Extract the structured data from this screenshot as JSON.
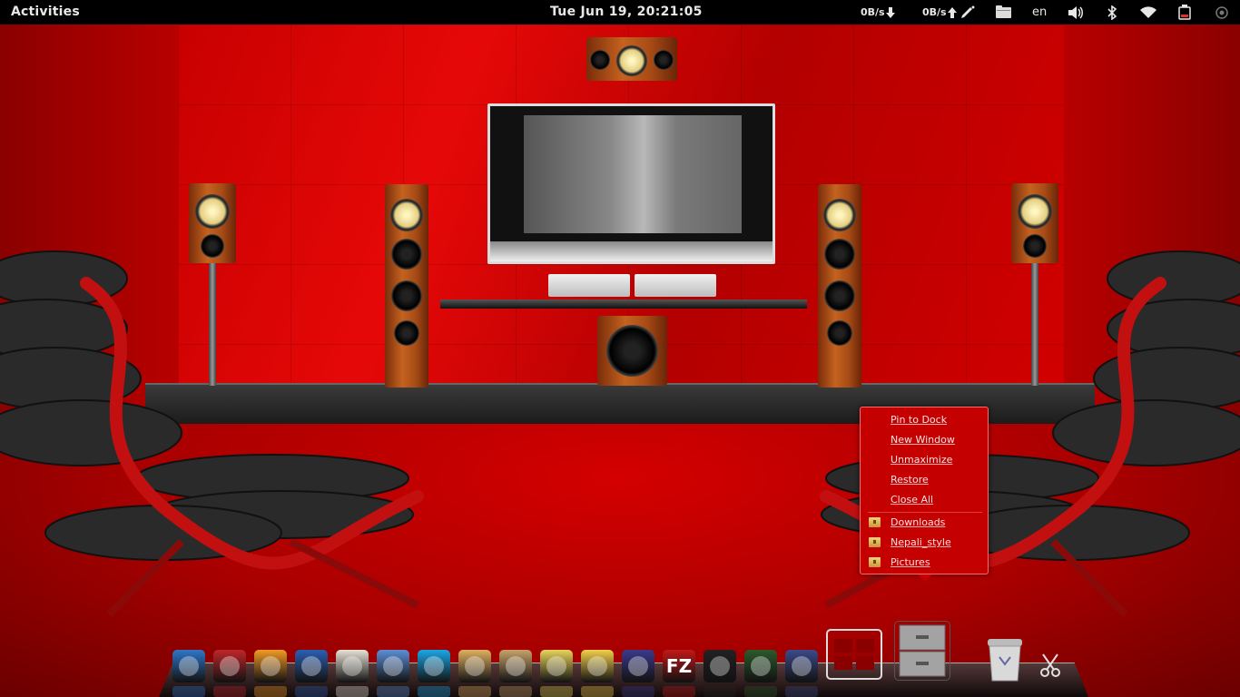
{
  "topbar": {
    "activities": "Activities",
    "clock": "Tue Jun 19, 20:21:05",
    "net_down": "0B/s",
    "net_up": "0B/s",
    "keyboard_layout": "en"
  },
  "context_menu": {
    "items": [
      {
        "label": "Pin to Dock"
      },
      {
        "label": "New Window"
      },
      {
        "label": "Unmaximize"
      },
      {
        "label": "Restore"
      },
      {
        "label": "Close All"
      }
    ],
    "places": [
      {
        "label": "Downloads"
      },
      {
        "label": "Nepali_style"
      },
      {
        "label": "Pictures"
      }
    ]
  },
  "dock": {
    "apps": [
      {
        "icon": "anchor-icon",
        "color": "#2f76c9"
      },
      {
        "icon": "terminal-icon",
        "color": "#c0262a"
      },
      {
        "icon": "inkscape-icon",
        "color": "#f19a26"
      },
      {
        "icon": "firefox-icon",
        "color": "#2b5fb4"
      },
      {
        "icon": "book-reader-icon",
        "color": "#e8e2d6"
      },
      {
        "icon": "chromium-icon",
        "color": "#5b8fd8"
      },
      {
        "icon": "skype-icon",
        "color": "#1aa6e6"
      },
      {
        "icon": "paint-icon",
        "color": "#e0b060"
      },
      {
        "icon": "gimp-icon",
        "color": "#c7a26a"
      },
      {
        "icon": "notes-icon",
        "color": "#e8d45a"
      },
      {
        "icon": "cheese-icon",
        "color": "#f2cf4a"
      },
      {
        "icon": "orb-icon",
        "color": "#3a3a8a"
      },
      {
        "icon": "filezilla-icon",
        "color": "#c01818",
        "text": "FZ"
      },
      {
        "icon": "camera-icon",
        "color": "#222222"
      },
      {
        "icon": "disk-icon",
        "color": "#2c5a2c"
      },
      {
        "icon": "avatar-icon",
        "color": "#3b4a8a"
      }
    ],
    "workspace": {
      "icon": "workspace-switcher-icon",
      "color": "#d11a1a"
    },
    "files": {
      "icon": "file-cabinet-icon",
      "color": "#8c8c8c"
    },
    "trash": {
      "icon": "trash-icon",
      "color": "#cfcfcf"
    },
    "scissors": {
      "icon": "scissors-icon",
      "color": "#e0e0e0"
    }
  }
}
